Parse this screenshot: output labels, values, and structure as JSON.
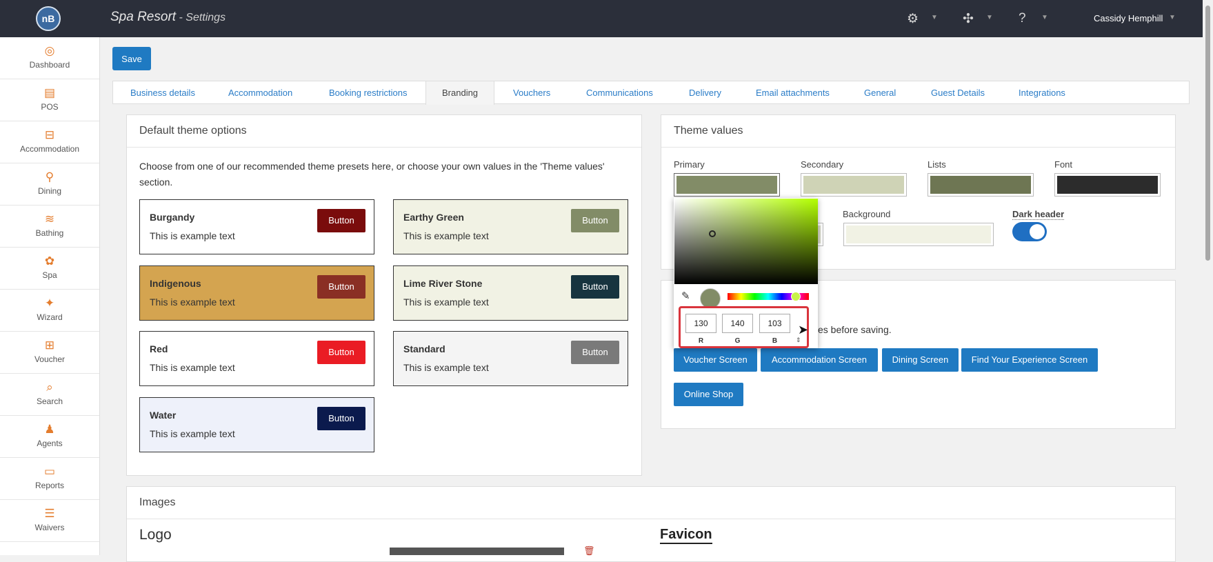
{
  "header": {
    "logo": "nB",
    "title": "Spa Resort",
    "subtitle": " - Settings",
    "user": "Cassidy Hemphill",
    "icons": [
      "settings-icon",
      "integrations-icon",
      "help-icon"
    ]
  },
  "sidebar": {
    "items": [
      {
        "label": "Dashboard",
        "icon": "◎"
      },
      {
        "label": "POS",
        "icon": "▤"
      },
      {
        "label": "Accommodation",
        "icon": "⊟"
      },
      {
        "label": "Dining",
        "icon": "⚲"
      },
      {
        "label": "Bathing",
        "icon": "≋"
      },
      {
        "label": "Spa",
        "icon": "✿"
      },
      {
        "label": "Wizard",
        "icon": "✦"
      },
      {
        "label": "Voucher",
        "icon": "⊞"
      },
      {
        "label": "Search",
        "icon": "⌕"
      },
      {
        "label": "Agents",
        "icon": "♟"
      },
      {
        "label": "Reports",
        "icon": "▭"
      },
      {
        "label": "Waivers",
        "icon": "☰"
      }
    ]
  },
  "toolbar": {
    "save_label": "Save"
  },
  "tabs": [
    "Business details",
    "Accommodation",
    "Booking restrictions",
    "Branding",
    "Vouchers",
    "Communications",
    "Delivery",
    "Email attachments",
    "General",
    "Guest Details",
    "Integrations"
  ],
  "active_tab": "Branding",
  "default_theme": {
    "title": "Default theme options",
    "description": "Choose from one of our recommended theme presets here, or choose your own values in the 'Theme values' section.",
    "themes": [
      {
        "name": "Burgandy",
        "text": "This is example text",
        "button": "Button",
        "bg": "#ffffff",
        "btn_color": "#7a0c0c"
      },
      {
        "name": "Earthy Green",
        "text": "This is example text",
        "button": "Button",
        "bg": "#f1f2e4",
        "btn_color": "#828c67"
      },
      {
        "name": "Indigenous",
        "text": "This is example text",
        "button": "Button",
        "bg": "#d4a450",
        "btn_color": "#8a2f24"
      },
      {
        "name": "Lime River Stone",
        "text": "This is example text",
        "button": "Button",
        "bg": "#f1f2e4",
        "btn_color": "#17343f"
      },
      {
        "name": "Red",
        "text": "This is example text",
        "button": "Button",
        "bg": "#ffffff",
        "btn_color": "#ea1c24"
      },
      {
        "name": "Standard",
        "text": "This is example text",
        "button": "Button",
        "bg": "#f4f4f4",
        "btn_color": "#7a7a7a"
      },
      {
        "name": "Water",
        "text": "This is example text",
        "button": "Button",
        "bg": "#eef1fa",
        "btn_color": "#0b1a4d"
      }
    ]
  },
  "theme_values": {
    "title": "Theme values",
    "primary_label": "Primary",
    "secondary_label": "Secondary",
    "lists_label": "Lists",
    "font_label": "Font",
    "background_label": "Background",
    "dark_header_label": "Dark header",
    "colors": {
      "primary": "#828c67",
      "secondary": "#cfd3b6",
      "lists": "#6e7653",
      "font": "#2c2c2c",
      "partial": "#d8dac8",
      "background": "#f1f2e4"
    },
    "dark_header": true
  },
  "preview": {
    "note": "es before saving.",
    "buttons": [
      "Voucher Screen",
      "Accommodation Screen",
      "Dining Screen",
      "Find Your Experience Screen",
      "Online Shop"
    ]
  },
  "color_picker": {
    "r": "130",
    "g": "140",
    "b": "103",
    "r_label": "R",
    "g_label": "G",
    "b_label": "B",
    "hex": "#828c67"
  },
  "images": {
    "title": "Images",
    "logo_heading": "Logo",
    "favicon_heading": "Favicon"
  }
}
